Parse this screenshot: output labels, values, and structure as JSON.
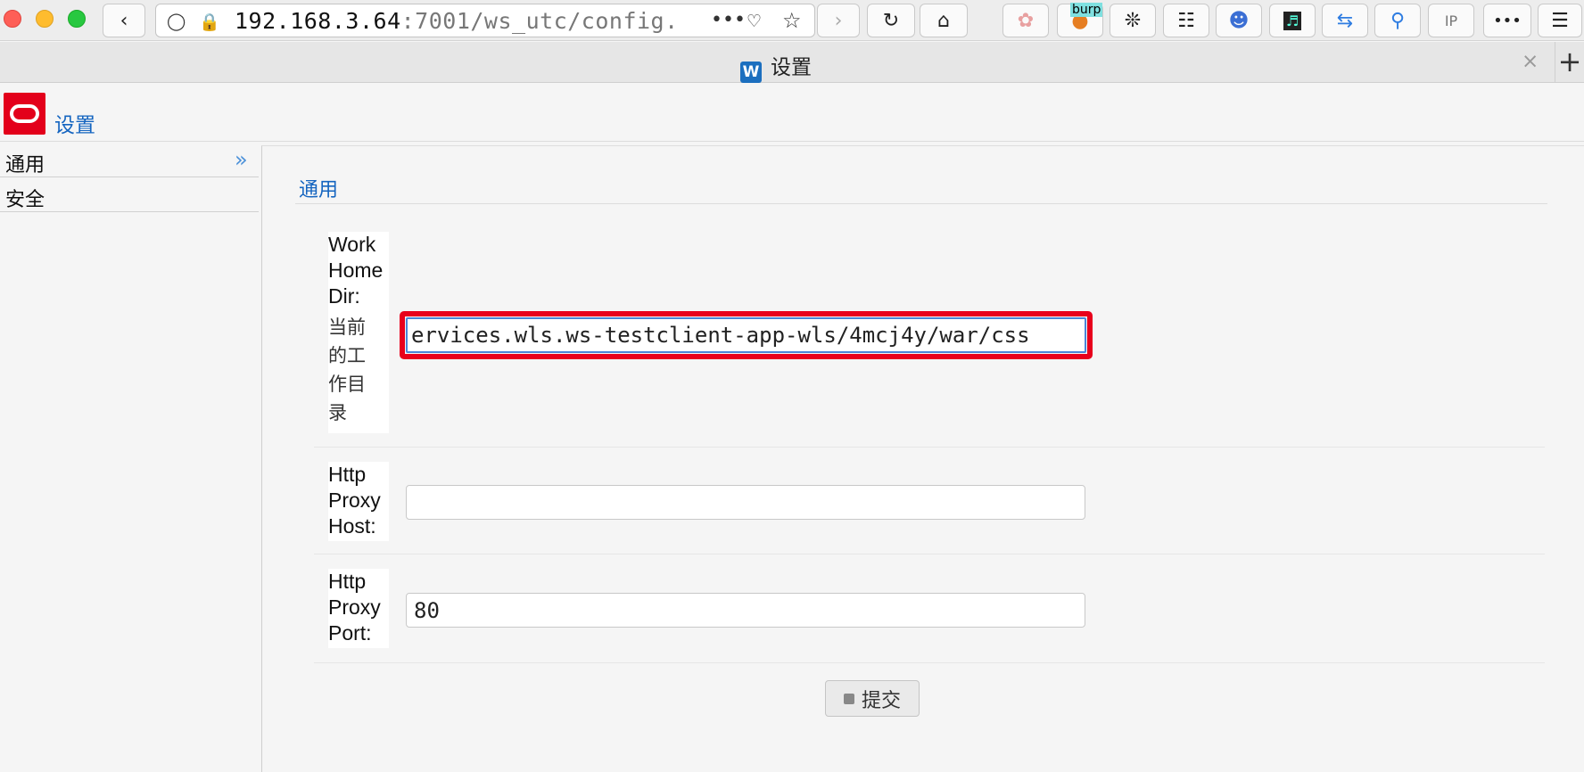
{
  "browser": {
    "url_host": "192.168.3.64",
    "url_path": ":7001/ws_utc/config.",
    "url_more": "•••",
    "tab_title": "设置",
    "tab_close": "×",
    "new_tab": "+",
    "extensions": [
      "burp-extension",
      "gnome-extension",
      "puzzle-extension",
      "anime-extension",
      "sound-extension",
      "sync-extension",
      "pin-extension",
      "ip-extension"
    ],
    "burp_label": "burp"
  },
  "app": {
    "title": "设置",
    "logo_brand_color": "#e3001b",
    "accent_color": "#1565c0"
  },
  "sidebar": {
    "items": [
      {
        "label": "通用",
        "active": true
      },
      {
        "label": "安全",
        "active": false
      }
    ],
    "expand_glyph": "»"
  },
  "main": {
    "section_title": "通用",
    "fields": {
      "work_home_dir": {
        "label_lines": [
          "Work",
          "Home",
          "Dir:"
        ],
        "hint_lines": [
          "当前",
          "的工",
          "作目",
          "录"
        ],
        "value": "ervices.wls.ws-testclient-app-wls/4mcj4y/war/css"
      },
      "http_proxy_host": {
        "label_lines": [
          "Http",
          "Proxy",
          "Host:"
        ],
        "value": ""
      },
      "http_proxy_port": {
        "label_lines": [
          "Http",
          "Proxy",
          "Port:"
        ],
        "value": "80"
      }
    },
    "submit_label": "提交",
    "highlight_color": "#e8001c"
  }
}
